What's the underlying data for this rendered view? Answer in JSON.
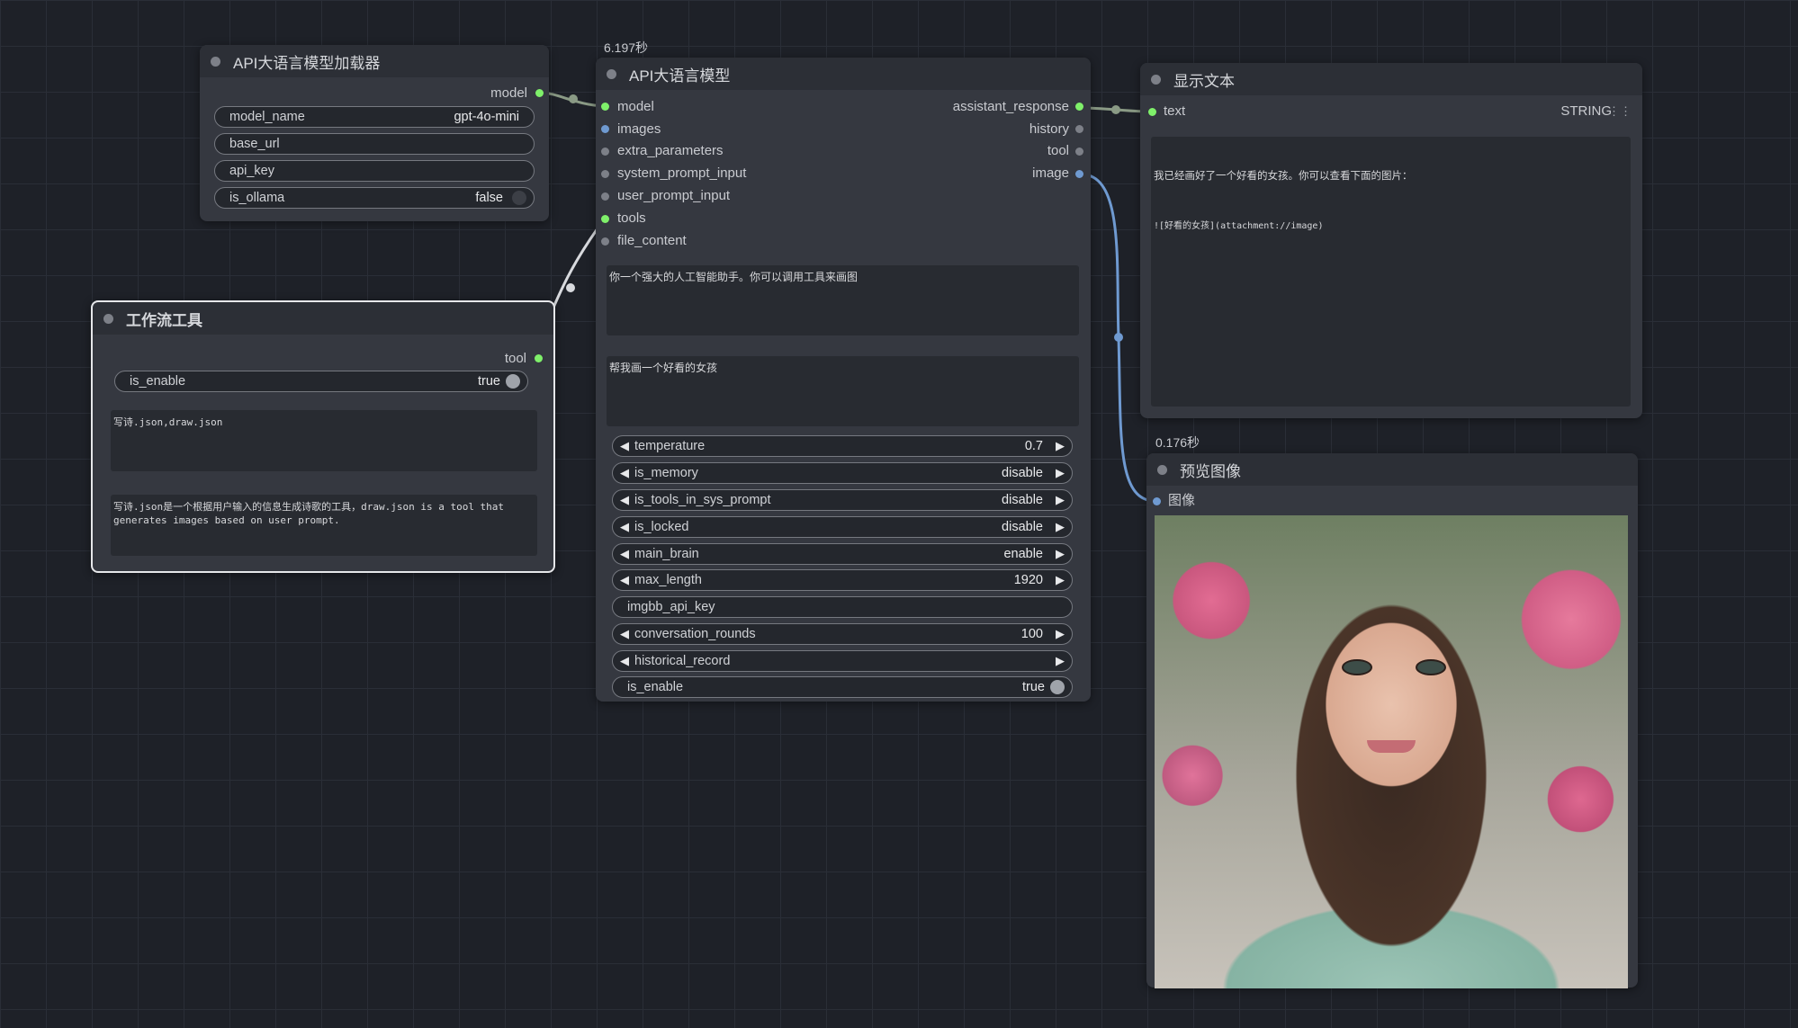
{
  "colors": {
    "green_slot": "#7ff06a",
    "blue_slot": "#6f9ad1",
    "gray_slot": "#7d8088",
    "canvas": "#1e2128"
  },
  "loader_node": {
    "title": "API大语言模型加载器",
    "output_model": "model",
    "widgets": [
      {
        "label": "model_name",
        "value": "gpt-4o-mini"
      },
      {
        "label": "base_url",
        "value": ""
      },
      {
        "label": "api_key",
        "value": ""
      },
      {
        "label": "is_ollama",
        "value": "false"
      }
    ]
  },
  "workflow_node": {
    "title": "工作流工具",
    "output_tool": "tool",
    "is_enable_label": "is_enable",
    "is_enable_value": "true",
    "text1": "写诗.json,draw.json",
    "text2": "写诗.json是一个根据用户输入的信息生成诗歌的工具，draw.json is a tool that generates images based on user prompt."
  },
  "llm_node": {
    "timing": "6.197秒",
    "title": "API大语言模型",
    "inputs": [
      "model",
      "images",
      "extra_parameters",
      "system_prompt_input",
      "user_prompt_input",
      "tools",
      "file_content"
    ],
    "outputs": [
      "assistant_response",
      "history",
      "tool",
      "image"
    ],
    "system_prompt": "你一个强大的人工智能助手。你可以调用工具来画图",
    "user_prompt": "帮我画一个好看的女孩",
    "widgets": [
      {
        "label": "temperature",
        "value": "0.7"
      },
      {
        "label": "is_memory",
        "value": "disable"
      },
      {
        "label": "is_tools_in_sys_prompt",
        "value": "disable"
      },
      {
        "label": "is_locked",
        "value": "disable"
      },
      {
        "label": "main_brain",
        "value": "enable"
      },
      {
        "label": "max_length",
        "value": "1920"
      },
      {
        "label": "imgbb_api_key",
        "value": ""
      },
      {
        "label": "conversation_rounds",
        "value": "100"
      },
      {
        "label": "historical_record",
        "value": ""
      },
      {
        "label": "is_enable",
        "value": "true"
      }
    ]
  },
  "text_node": {
    "title": "显示文本",
    "input_label": "text",
    "type_label": "STRING",
    "line1": "我已经画好了一个好看的女孩。你可以查看下面的图片：",
    "line2": "![好看的女孩](attachment://image)"
  },
  "preview_node": {
    "timing": "0.176秒",
    "title": "预览图像",
    "input_label": "图像"
  }
}
